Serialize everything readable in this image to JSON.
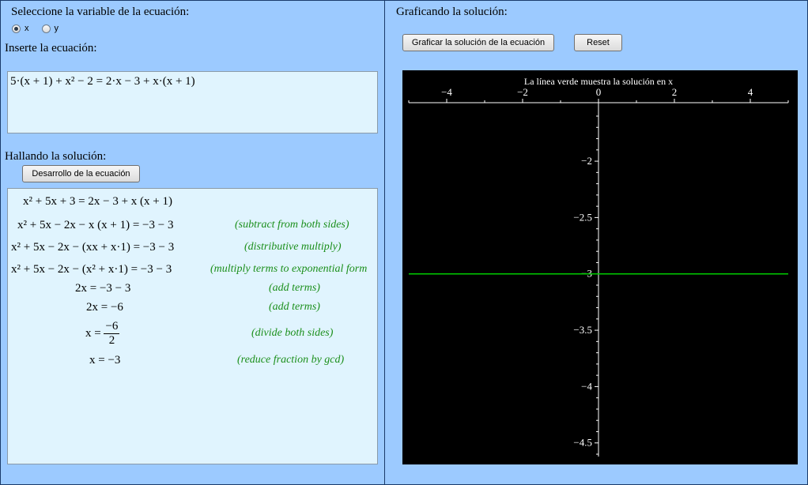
{
  "left": {
    "variable_label": "Seleccione la variable de la ecuación:",
    "radio_options": [
      {
        "label": "x",
        "selected": true
      },
      {
        "label": "y",
        "selected": false
      }
    ],
    "input_label": "Inserte la ecuación:",
    "equation_input": "5·(x + 1) + x² − 2 = 2·x − 3 + x·(x + 1)",
    "solution_label": "Hallando la solución:",
    "develop_button": "Desarrollo de la ecuación",
    "steps": [
      {
        "expr": "x² + 5x + 3 = 2x − 3 + x (x + 1)",
        "note": ""
      },
      {
        "expr": "x² + 5x − 2x − x (x + 1) = −3 − 3",
        "note": "(subtract from both sides)"
      },
      {
        "expr": "x² + 5x − 2x − (xx + x·1) = −3 − 3",
        "note": "(distributive multiply)"
      },
      {
        "expr": "x² + 5x − 2x − (x² + x·1) = −3 − 3",
        "note": "(multiply terms to exponential form"
      },
      {
        "expr": "2x = −3 − 3",
        "note": "(add terms)"
      },
      {
        "expr": "2x = −6",
        "note": "(add terms)"
      },
      {
        "expr_lhs": "x =",
        "frac_num": "−6",
        "frac_den": "2",
        "note": "(divide both sides)"
      },
      {
        "expr": "x = −3",
        "note": "(reduce fraction by gcd)"
      }
    ]
  },
  "right": {
    "title": "Graficando la solución:",
    "graph_button": "Graficar la solución de la ecuación",
    "reset_button": "Reset"
  },
  "colors": {
    "background": "#9ccaff",
    "box": "#e0f4fe",
    "solution_line": "#00cc00",
    "note": "#1b8f1b"
  },
  "chart_data": {
    "type": "line",
    "title": "La línea verde muestra la solución en x",
    "xlim": [
      -5,
      5
    ],
    "ylim": [
      -4.6,
      -1.6
    ],
    "x_ticks": [
      -4,
      -2,
      0,
      2,
      4
    ],
    "y_ticks": [
      -2,
      -2.5,
      -3,
      -3.5,
      -4,
      -4.5
    ],
    "series": [
      {
        "x": [
          -5,
          5
        ],
        "y": [
          -3,
          -3
        ],
        "color": "#00cc00"
      }
    ]
  }
}
